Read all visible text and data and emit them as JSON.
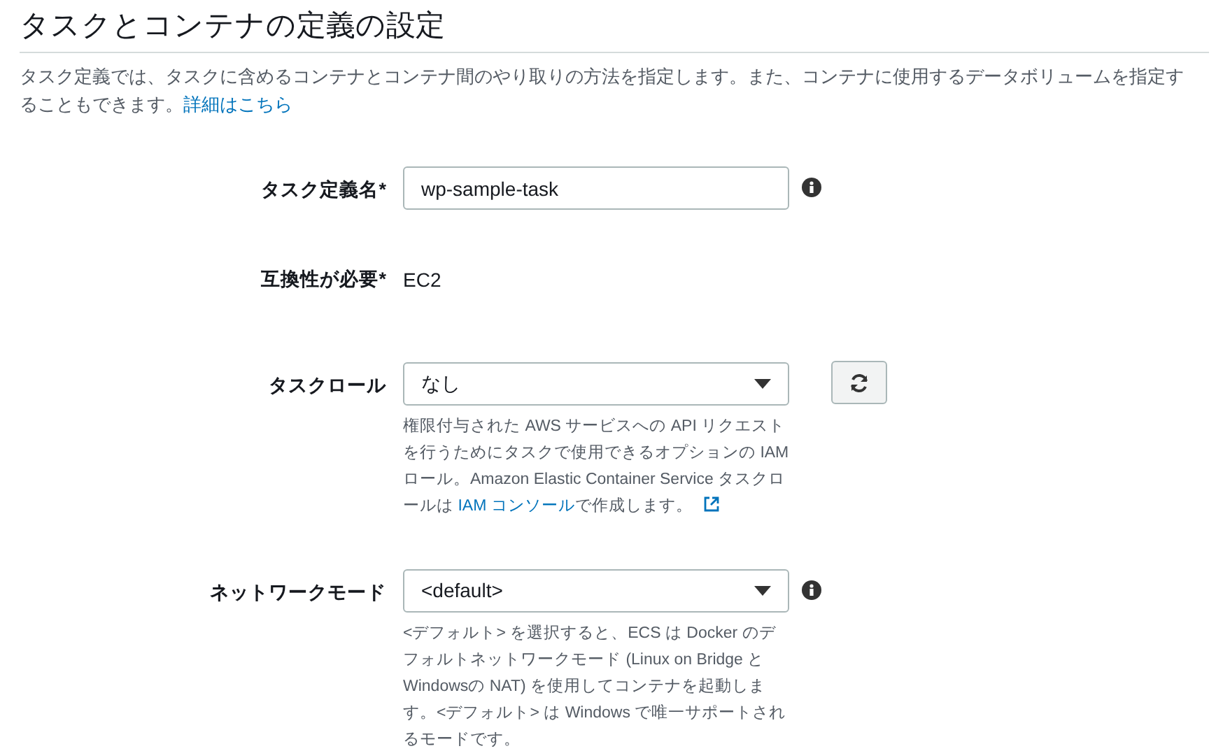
{
  "title": "タスクとコンテナの定義の設定",
  "description": {
    "text": "タスク定義では、タスクに含めるコンテナとコンテナ間のやり取りの方法を指定します。また、コンテナに使用するデータボリュームを指定することもできます。",
    "link": "詳細はこちら"
  },
  "fields": [
    {
      "kind": "text_input",
      "label": "タスク定義名*",
      "value": "wp-sample-task",
      "info": true
    },
    {
      "kind": "static",
      "label": "互換性が必要*",
      "value": "EC2",
      "info": false
    },
    {
      "kind": "select",
      "label": "タスクロール",
      "value": "なし",
      "info": false,
      "refresh_button": true,
      "external_link": true,
      "help": [
        {
          "kind": "text",
          "text": "権限付与された AWS サービスへの API リクエストを行うためにタスクで使用できるオプションの IAM ロール。Amazon Elastic Container Service タスクロールは "
        },
        {
          "kind": "link",
          "text": "IAM コンソール"
        },
        {
          "kind": "text",
          "text": "で作成します。"
        }
      ]
    },
    {
      "kind": "select",
      "label": "ネットワークモード",
      "value": "<default>",
      "info": true,
      "refresh_button": false,
      "external_link": false,
      "help": [
        {
          "kind": "text",
          "text": "<デフォルト> を選択すると、ECS は Docker のデフォルトネットワークモード (Linux on Bridge と Windowsの NAT) を使用してコンテナを起動します。<デフォルト> は Windows で唯一サポートされるモードです。"
        }
      ]
    }
  ]
}
